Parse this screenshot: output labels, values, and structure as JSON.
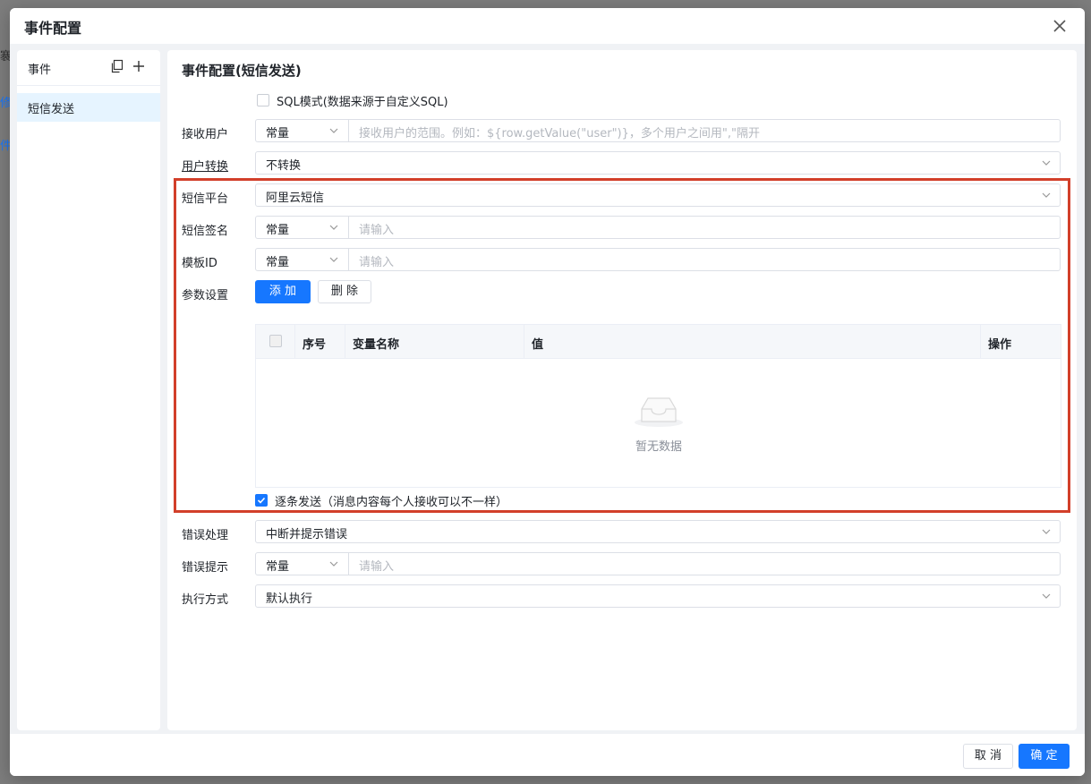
{
  "background": {
    "fragments": [
      "褰",
      "修",
      "件"
    ]
  },
  "modal": {
    "title": "事件配置",
    "footer": {
      "cancel_label": "取 消",
      "ok_label": "确 定"
    }
  },
  "left_panel": {
    "header_label": "事件",
    "items": [
      {
        "label": "短信发送"
      }
    ]
  },
  "form": {
    "section_title": "事件配置(短信发送)",
    "sql_mode": {
      "label": "SQL模式(数据来源于自定义SQL)",
      "checked": false
    },
    "receive_user": {
      "label": "接收用户",
      "type_value": "常量",
      "placeholder": "接收用户的范围。例如：${row.getValue(\"user\")}，多个用户之间用\",\"隔开"
    },
    "user_convert": {
      "label": "用户转换",
      "value": "不转换"
    },
    "sms_platform": {
      "label": "短信平台",
      "value": "阿里云短信"
    },
    "sms_sign": {
      "label": "短信签名",
      "type_value": "常量",
      "placeholder": "请输入"
    },
    "template_id": {
      "label": "模板ID",
      "type_value": "常量",
      "placeholder": "请输入"
    },
    "params": {
      "label": "参数设置",
      "add_label": "添 加",
      "delete_label": "删 除",
      "table": {
        "columns": [
          "序号",
          "变量名称",
          "值",
          "操作"
        ],
        "rows": [],
        "empty_text": "暂无数据"
      }
    },
    "send_one_by_one": {
      "label": "逐条发送（消息内容每个人接收可以不一样）",
      "checked": true
    },
    "error_handling": {
      "label": "错误处理",
      "value": "中断并提示错误"
    },
    "error_prompt": {
      "label": "错误提示",
      "type_value": "常量",
      "placeholder": "请输入"
    },
    "exec_mode": {
      "label": "执行方式",
      "value": "默认执行"
    }
  },
  "colors": {
    "primary": "#1677ff",
    "highlight_frame": "#d23f2a"
  }
}
